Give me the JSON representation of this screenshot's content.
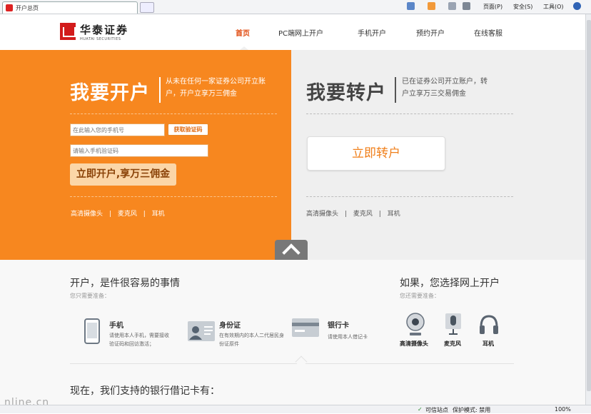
{
  "browser": {
    "tab_title": "开户总页",
    "toolbar": {
      "page": "页面(P)",
      "safety": "安全(S)",
      "tools": "工具(O)"
    },
    "status": {
      "trusted": "可信站点",
      "protected": "保护模式: 禁用",
      "zoom": "100%"
    },
    "watermark": "nline.cn"
  },
  "header": {
    "brand": "华泰证券",
    "brand_en": "HUATAI SECURITIES",
    "nav": [
      "首页",
      "PC端网上开户",
      "手机开户",
      "预约开户",
      "在线客服"
    ]
  },
  "open_account": {
    "title": "我要开户",
    "desc": "从未在任何一家证券公司开立账户，开户立享万三佣金",
    "phone_placeholder": "在此输入您的手机号",
    "get_code": "获取验证码",
    "code_placeholder": "请输入手机验证码",
    "submit": "立即开户,享万三佣金",
    "requirements": [
      "高清摄像头",
      "麦克风",
      "耳机"
    ]
  },
  "transfer_account": {
    "title": "我要转户",
    "desc": "已在证券公司开立账户，转户立享万三交易佣金",
    "submit": "立即转户",
    "requirements": [
      "高清摄像头",
      "麦克风",
      "耳机"
    ]
  },
  "prep": {
    "title": "开户，是件很容易的事情",
    "subtitle": "您只需要准备：",
    "items": [
      {
        "title": "手机",
        "desc": "请使用本人手机，需要接收验证码和回访激活；"
      },
      {
        "title": "身份证",
        "desc": "在有效期内的本人二代居民身份证原件"
      },
      {
        "title": "银行卡",
        "desc": "请使用本人借记卡"
      }
    ]
  },
  "online": {
    "title": "如果，您选择网上开户",
    "subtitle": "您还需要准备：",
    "devices": [
      "高清摄像头",
      "麦克风",
      "耳机"
    ]
  },
  "banks": {
    "title": "现在，我们支持的银行借记卡有："
  },
  "colors": {
    "accent": "#f7871f",
    "nav_active": "#e04a0f",
    "transfer_btn": "#f07f1a"
  }
}
